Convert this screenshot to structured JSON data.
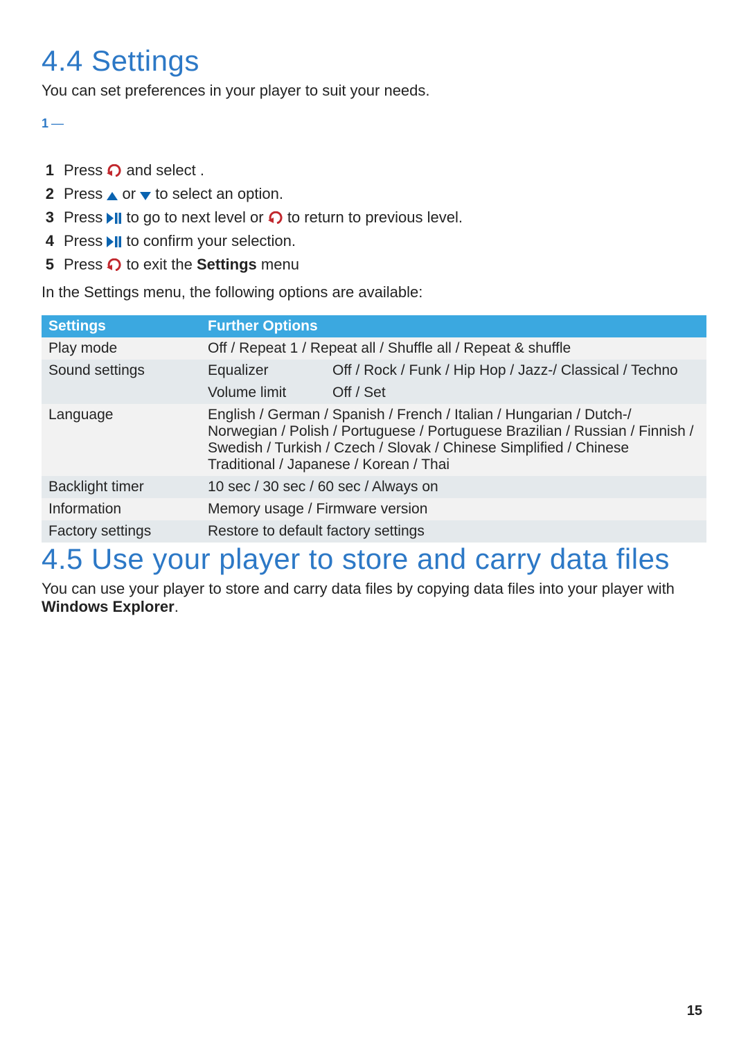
{
  "section44": {
    "heading": "4.4  Settings",
    "intro": "You can set preferences in your player to suit your needs.",
    "ref": "1",
    "ref_dash": "—",
    "steps": [
      {
        "pre": "Press ",
        "icon": "back",
        "post": " and select    ."
      },
      {
        "pre": "Press ",
        "icon": "updown",
        "post": " to select an option."
      },
      {
        "pre": "Press ",
        "icon": "playpause",
        "mid": " to go to next level or ",
        "icon2": "back",
        "post": " to return to previous level."
      },
      {
        "pre": "Press ",
        "icon": "playpause",
        "post": " to confirm your selection."
      },
      {
        "pre": "Press ",
        "icon": "back",
        "post_a": " to exit the ",
        "bold": "Settings",
        "post_b": " menu"
      }
    ],
    "below": "In the Settings menu, the following options are available:"
  },
  "table": {
    "head": {
      "settings": "Settings",
      "further": "Further Options"
    },
    "rows": [
      {
        "band": 0,
        "setting": "Play mode",
        "sub": "",
        "opts": "Off / Repeat 1 / Repeat all / Shuffle all / Repeat & shuffle"
      },
      {
        "band": 1,
        "setting": "Sound settings",
        "sub": "Equalizer",
        "opts": "Off / Rock / Funk / Hip Hop / Jazz-/ Classical / Techno"
      },
      {
        "band": 1,
        "setting": "",
        "sub": "Volume limit",
        "opts": "Off / Set"
      },
      {
        "band": 0,
        "setting": "Language",
        "sub": "",
        "opts": "English / German / Spanish / French / Italian / Hungarian / Dutch-/ Norwegian / Polish / Portuguese / Portuguese Brazilian / Russian / Finnish / Swedish / Turkish / Czech / Slovak / Chinese Simplified / Chinese Traditional / Japanese / Korean / Thai"
      },
      {
        "band": 1,
        "setting": "Backlight timer",
        "sub": "",
        "opts": "10 sec / 30 sec / 60 sec / Always on"
      },
      {
        "band": 0,
        "setting": "Information",
        "sub": "",
        "opts": "Memory usage / Firmware version"
      },
      {
        "band": 1,
        "setting": "Factory settings",
        "sub": "",
        "opts": "Restore to default factory settings"
      }
    ]
  },
  "section45": {
    "heading": "4.5  Use your player to store and carry data files",
    "body_a": "You can use your player to store and carry data files by copying data files into your player with ",
    "body_bold": "Windows Explorer",
    "body_b": "."
  },
  "page_number": "15"
}
